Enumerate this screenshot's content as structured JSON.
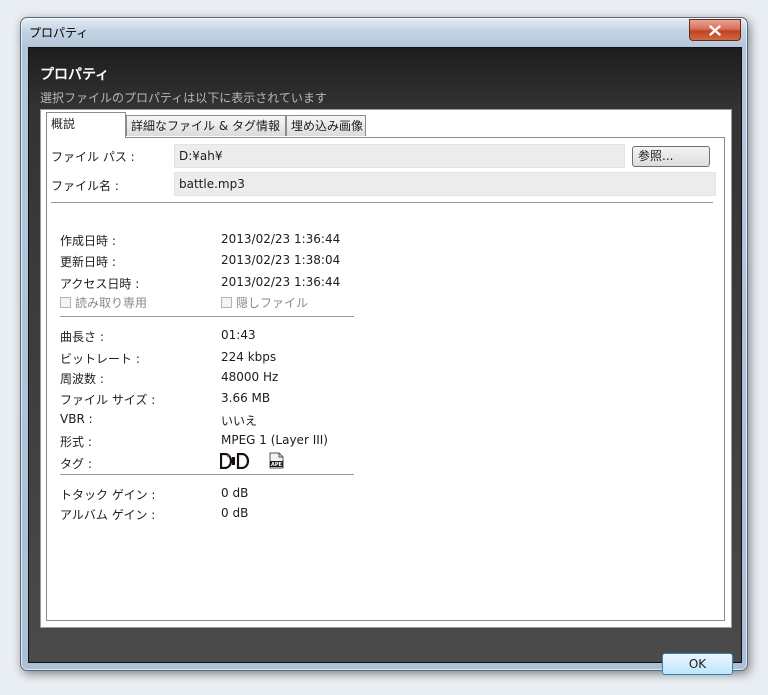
{
  "window": {
    "title": "プロパティ"
  },
  "header": {
    "title": "プロパティ",
    "subtitle": "選択ファイルのプロパティは以下に表示されています"
  },
  "tabs": [
    {
      "label": "概説"
    },
    {
      "label": "詳細なファイル & タグ情報"
    },
    {
      "label": "埋め込み画像"
    }
  ],
  "file": {
    "path_label": "ファイル パス :",
    "path_value": "D:¥ah¥",
    "browse_label": "参照...",
    "name_label": "ファイル名 :",
    "name_value": "battle.mp3"
  },
  "dates": {
    "created_label": "作成日時 :",
    "created_value": "2013/02/23 1:36:44",
    "modified_label": "更新日時 :",
    "modified_value": "2013/02/23 1:38:04",
    "accessed_label": "アクセス日時 :",
    "accessed_value": "2013/02/23 1:36:44",
    "readonly_label": "読み取り専用",
    "hidden_label": "隠しファイル"
  },
  "audio": {
    "length_label": "曲長さ :",
    "length_value": "01:43",
    "bitrate_label": "ビットレート :",
    "bitrate_value": "224 kbps",
    "frequency_label": "周波数 :",
    "frequency_value": "48000 Hz",
    "size_label": "ファイル サイズ :",
    "size_value": "3.66 MB",
    "vbr_label": "VBR :",
    "vbr_value": "いいえ",
    "format_label": "形式 :",
    "format_value": "MPEG 1 (Layer III)",
    "tag_label": "タグ :",
    "tag_icons": [
      "id3-tag-icon",
      "ape-tag-icon"
    ],
    "ape_text": "APE"
  },
  "gain": {
    "track_label": "トタック ゲイン :",
    "track_value": "0 dB",
    "album_label": "アルバム ゲイン :",
    "album_value": "0 dB"
  },
  "buttons": {
    "ok": "OK"
  }
}
